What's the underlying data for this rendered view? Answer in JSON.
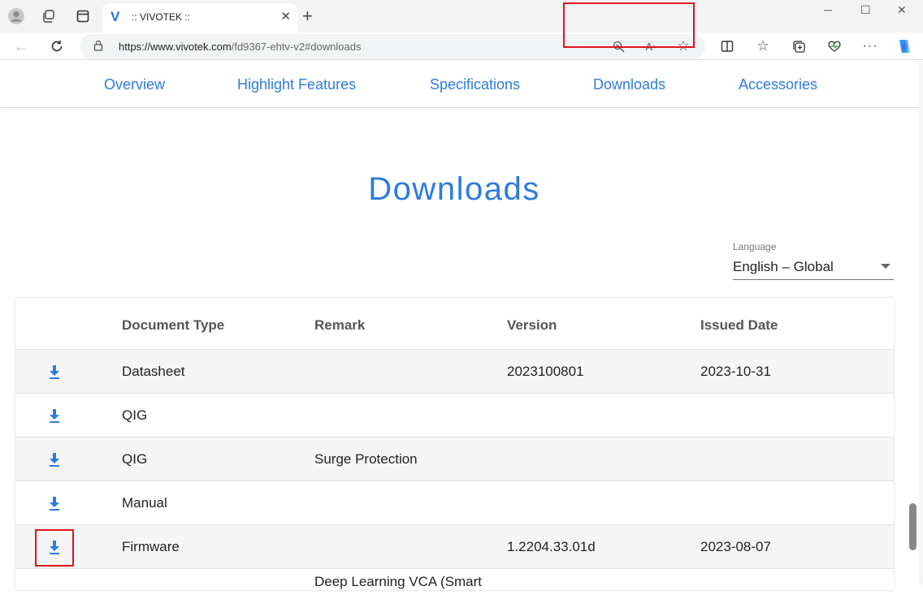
{
  "browser": {
    "tab_title": ":: VIVOTEK ::",
    "url_host": "https://www.vivotek.com",
    "url_path": "/fd9367-ehtv-v2#downloads"
  },
  "page_nav": {
    "items": [
      "Overview",
      "Highlight Features",
      "Specifications",
      "Downloads",
      "Accessories"
    ],
    "active": "Downloads"
  },
  "heading": "Downloads",
  "language": {
    "label": "Language",
    "value": "English – Global"
  },
  "table": {
    "headers": [
      "Document Type",
      "Remark",
      "Version",
      "Issued Date"
    ],
    "rows": [
      {
        "type": "Datasheet",
        "remark": "",
        "version": "2023100801",
        "date": "2023-10-31"
      },
      {
        "type": "QIG",
        "remark": "",
        "version": "",
        "date": ""
      },
      {
        "type": "QIG",
        "remark": "Surge Protection",
        "version": "",
        "date": ""
      },
      {
        "type": "Manual",
        "remark": "",
        "version": "",
        "date": ""
      },
      {
        "type": "Firmware",
        "remark": "",
        "version": "1.2204.33.01d",
        "date": "2023-08-07"
      },
      {
        "type": "",
        "remark": "Deep Learning VCA (Smart",
        "version": "",
        "date": ""
      }
    ]
  },
  "colors": {
    "brand_blue": "#2d7be0",
    "highlight_red": "#e0141e"
  },
  "icons": [
    "profile-icon",
    "workspaces-icon",
    "tab-actions-icon",
    "back-icon",
    "refresh-icon",
    "lock-icon",
    "zoom-icon",
    "read-aloud-icon",
    "favorite-icon",
    "split-screen-icon",
    "favorites-icon",
    "collections-icon",
    "performance-icon",
    "more-icon",
    "copilot-icon",
    "download-icon"
  ]
}
